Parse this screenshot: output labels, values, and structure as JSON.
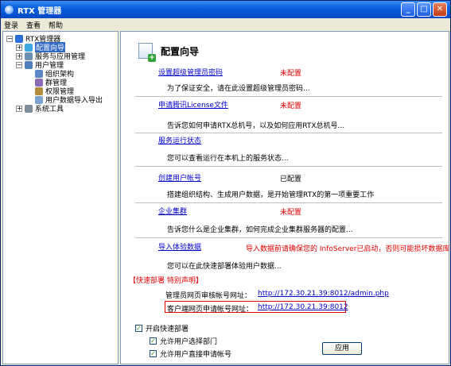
{
  "window": {
    "title": "RTX 管理器"
  },
  "menu": [
    "登录",
    "查看",
    "帮助"
  ],
  "tree": {
    "root": "RTX管理器",
    "items": [
      {
        "label": "配置向导",
        "selected": true
      },
      {
        "label": "服务与应用管理"
      },
      {
        "label": "用户管理"
      },
      {
        "label": "组织架构"
      },
      {
        "label": "群管理"
      },
      {
        "label": "权限管理"
      },
      {
        "label": "用户数据导入导出"
      },
      {
        "label": "系统工具"
      }
    ]
  },
  "main": {
    "title": "配置向导",
    "sections": [
      {
        "link": "设置超级管理员密码",
        "status": "未配置",
        "status_color": "#E00000",
        "desc": "为了保证安全，请在此设置超级管理员密码..."
      },
      {
        "link": "申请腾讯License文件",
        "status": "未配置",
        "status_color": "#E00000",
        "desc": "告诉您如何申请RTX总机号，以及如何应用RTX总机号..."
      },
      {
        "link": "服务运行状态",
        "status": "",
        "desc": "您可以查看运行在本机上的服务状态..."
      },
      {
        "link": "创建用户帐号",
        "status": "已配置",
        "status_color": "#000000",
        "desc": "搭建组织结构、生成用户数据，是开始管理RTX的第一项重要工作"
      },
      {
        "link": "企业集群",
        "status": "未配置",
        "status_color": "#E00000",
        "desc": "告诉您什么是企业集群，如何完成企业集群服务器的配置..."
      },
      {
        "link": "导入体验数据",
        "status": "导入数据前请确保您的 InfoServer已启动，否则可能损坏数据库",
        "status_color": "#E00000",
        "desc": "您可以在此快速部署体验用户数据..."
      }
    ],
    "quick_deploy": {
      "header": "【快速部署  特别声明】",
      "admin_label": "管理员网页审核帐号网址：",
      "admin_url": "http://172.30.21.39:8012/admin.php",
      "client_label": "客户端网页申请帐号网址：",
      "client_url": "http://172.30.21.39:8012"
    },
    "options": {
      "enable": "开启快速部署",
      "allow_dept": "允许用户选择部门",
      "allow_direct": "允许用户直接申请帐号"
    },
    "apply_button": "应用"
  }
}
